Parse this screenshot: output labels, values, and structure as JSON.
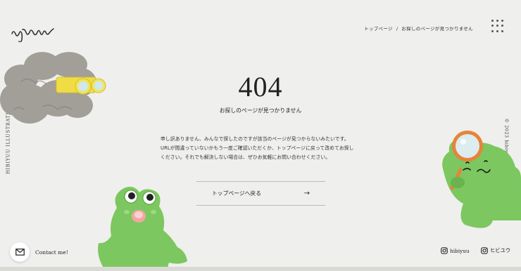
{
  "breadcrumb": {
    "home": "トップページ",
    "separator": "/",
    "current": "お探しのページが見つかりません"
  },
  "side": {
    "left": "HIBIYUU ILLUSTRATIONS",
    "right": "© 2023 hibiyuu"
  },
  "main": {
    "code": "404",
    "subtitle": "お探しのページが見つかりません",
    "message_lines": [
      "申し訳ありません、みんなで探したのですが該当のページが見つからないみたいです。",
      "URLが間違っていないかもう一度ご確認いただくか、トップページに戻って改めてお探し",
      "ください。それでも解決しない場合は、ぜひお気軽にお問い合わせください。"
    ],
    "back_label": "トップページへ戻る",
    "back_arrow": "→"
  },
  "footer": {
    "contact_label": "Contact me!",
    "social": [
      {
        "icon": "instagram-icon",
        "label": "hibiyuu"
      },
      {
        "icon": "instagram-icon",
        "label": "ヒビユウ"
      }
    ]
  },
  "colors": {
    "background": "#efefed",
    "frog_green": "#7cc75f",
    "cloud_gray": "#9f9c97",
    "binocular_yellow": "#f2e24a",
    "magnifier_orange": "#e8833a"
  }
}
